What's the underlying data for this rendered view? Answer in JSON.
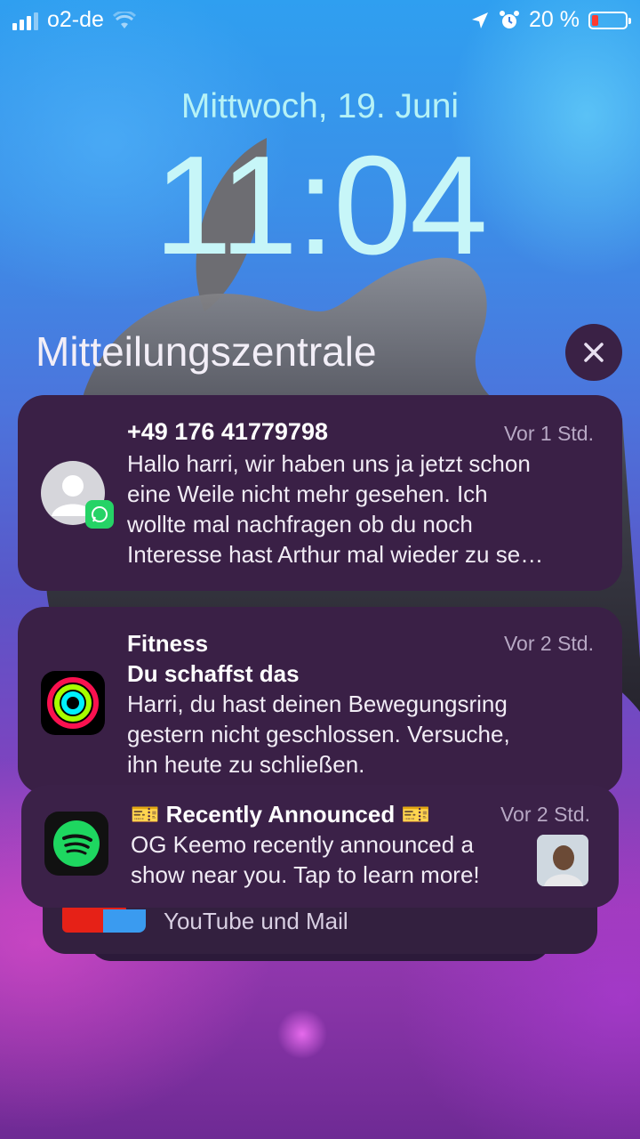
{
  "status_bar": {
    "carrier": "o2-de",
    "battery_percent": "20 %",
    "battery_level": 0.2,
    "icons": [
      "signal-icon",
      "wifi-icon",
      "location-arrow-icon",
      "alarm-clock-icon",
      "battery-icon"
    ]
  },
  "lock_screen": {
    "date": "Mittwoch, 19. Juni",
    "time": "11:04"
  },
  "notification_center": {
    "title": "Mitteilungszentrale",
    "close_icon": "close-icon"
  },
  "notifications": [
    {
      "app_icon": "whatsapp-contact-avatar-icon",
      "title": "+49 176 41779798",
      "time": "Vor 1 Std.",
      "lines": [
        "Hallo harri, wir haben uns ja jetzt schon",
        "eine Weile nicht mehr gesehen. Ich",
        "wollte mal nachfragen ob du noch",
        "Interesse hast Arthur mal wieder zu se…"
      ]
    },
    {
      "app_icon": "fitness-rings-icon",
      "app_name": "Fitness",
      "time": "Vor 2 Std.",
      "title": "Du schaffst das",
      "lines": [
        "Harri, du hast deinen Bewegungsring",
        "gestern nicht geschlossen. Versuche,",
        "ihn heute zu schließen."
      ]
    },
    {
      "app_icon": "spotify-icon",
      "title": "🎫 Recently Announced 🎫",
      "time": "Vor 2 Std.",
      "lines": [
        "OG Keemo recently announced a",
        "show near you. Tap to learn more!"
      ],
      "attachment": "artist-photo-thumbnail"
    }
  ],
  "stacked_group": {
    "text": "YouTube und Mail",
    "icons": [
      "youtube-icon",
      "mail-icon"
    ]
  },
  "colors": {
    "card_background": "#3a2046",
    "date_time_color": "#c7f6f8",
    "battery_red": "#ff3b30"
  }
}
